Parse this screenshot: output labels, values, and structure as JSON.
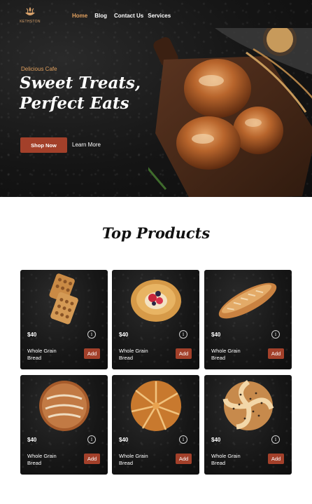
{
  "brand": {
    "logo_text": "KETHSTON"
  },
  "nav": {
    "items": [
      "Home",
      "Blog",
      "Contact Us",
      "Services"
    ],
    "active_index": 0
  },
  "hero": {
    "eyebrow": "Delicious Cafe",
    "headline_line1": "Sweet Treats,",
    "headline_line2": "Perfect Eats",
    "primary_button": "Shop Now",
    "secondary_link": "Learn More"
  },
  "products": {
    "title": "Top Products",
    "items": [
      {
        "price": "$40",
        "name": "Whole Grain Bread",
        "add_label": "Add",
        "image": "waffle-pastry"
      },
      {
        "price": "$40",
        "name": "Whole Grain Bread",
        "add_label": "Add",
        "image": "berry-danish"
      },
      {
        "price": "$40",
        "name": "Whole Grain Bread",
        "add_label": "Add",
        "image": "baguette"
      },
      {
        "price": "$40",
        "name": "Whole Grain Bread",
        "add_label": "Add",
        "image": "sourdough-loaf"
      },
      {
        "price": "$40",
        "name": "Whole Grain Bread",
        "add_label": "Add",
        "image": "pull-apart-round"
      },
      {
        "price": "$40",
        "name": "Whole Grain Bread",
        "add_label": "Add",
        "image": "seeded-bun"
      }
    ]
  },
  "colors": {
    "accent": "#a3402a",
    "highlight": "#e2a15f",
    "dark": "#141414"
  },
  "icons": {
    "info": "info-icon",
    "logo": "wheat-cup-logo-icon"
  }
}
